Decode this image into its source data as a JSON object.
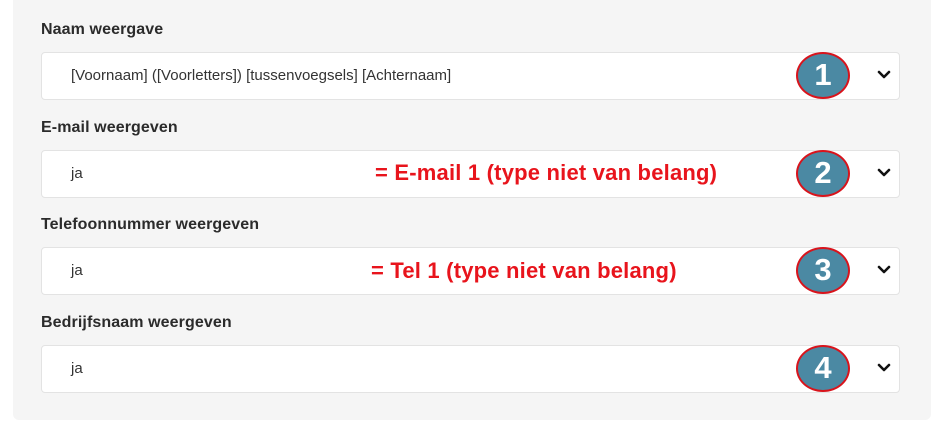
{
  "fields": [
    {
      "label": "Naam weergave",
      "value": "[Voornaam] ([Voorletters]) [tussenvoegsels] [Achternaam]",
      "badge": "1"
    },
    {
      "label": "E-mail weergeven",
      "value": "ja",
      "badge": "2",
      "annotation": "= E-mail 1 (type niet van belang)"
    },
    {
      "label": "Telefoonnummer weergeven",
      "value": "ja",
      "badge": "3",
      "annotation": "= Tel 1 (type niet van belang)"
    },
    {
      "label": "Bedrijfsnaam weergeven",
      "value": "ja",
      "badge": "4"
    }
  ],
  "colors": {
    "annotation": "#e8141c",
    "badge_fill": "#4b89a3",
    "badge_border": "#d8141c"
  },
  "icons": {
    "dropdown": "chevron-down-icon"
  }
}
